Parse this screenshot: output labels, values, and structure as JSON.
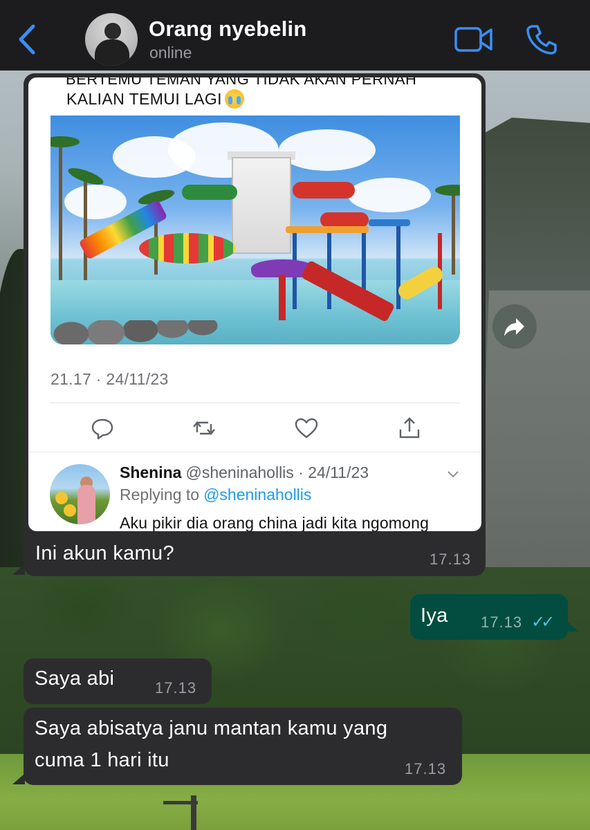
{
  "header": {
    "contact_name": "Orang nyebelin",
    "status": "online",
    "icons": [
      "chevron-left-icon",
      "video-camera-icon",
      "phone-icon"
    ]
  },
  "shared_tweet": {
    "cut_text": "BERTEMU TEMAN YANG TIDAK AKAN PERNAH",
    "text": "KALIAN TEMUI LAGI",
    "emoji": "loudly-crying-face",
    "timestamp": "21.17 · 24/11/23",
    "actions": [
      "reply-icon",
      "retweet-icon",
      "like-icon",
      "share-icon"
    ],
    "reply": {
      "name": "Shenina",
      "handle_date": "@sheninahollis · 24/11/23",
      "replying_label": "Replying to",
      "replying_to": "@sheninahollis",
      "text": "Aku pikir dia orang china jadi kita ngomong"
    }
  },
  "messages": [
    {
      "direction": "in",
      "text": "Ini akun kamu?",
      "time": "17.13"
    },
    {
      "direction": "out",
      "text": "Iya",
      "time": "17.13",
      "read": "✓✓"
    },
    {
      "direction": "in",
      "text": "Saya abi",
      "time": "17.13"
    },
    {
      "direction": "in",
      "lines": [
        "Saya abisatya janu mantan kamu yang",
        "cuma 1 hari itu"
      ],
      "time": "17.13"
    }
  ],
  "colors": {
    "header_bg": "#1c1c1e",
    "accent_blue": "#3b8ef5",
    "incoming_bubble": "#2c2c2e",
    "outgoing_bubble": "#024d3f",
    "read_ticks": "#53bdeb",
    "link": "#1d9bf0"
  }
}
